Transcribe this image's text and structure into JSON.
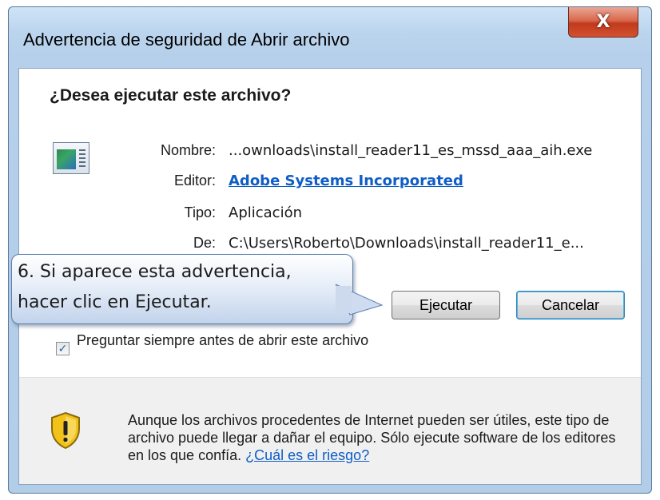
{
  "dialog": {
    "title": "Advertencia de seguridad de Abrir archivo",
    "close_label": "X",
    "question": "¿Desea ejecutar este archivo?",
    "fields": {
      "name_label": "Nombre:",
      "name_value": "...ownloads\\install_reader11_es_mssd_aaa_aih.exe",
      "publisher_label": "Editor:",
      "publisher_value": "Adobe Systems Incorporated",
      "type_label": "Tipo:",
      "type_value": "Aplicación",
      "from_label": "De:",
      "from_value": "C:\\Users\\Roberto\\Downloads\\install_reader11_e..."
    },
    "buttons": {
      "run": "Ejecutar",
      "cancel": "Cancelar"
    },
    "checkbox": {
      "label": "Preguntar siempre antes de abrir este archivo",
      "checked": true
    },
    "warning": {
      "text": "Aunque los archivos procedentes de Internet pueden ser útiles, este tipo de archivo puede llegar a dañar el equipo. Sólo ejecute software de los editores en los que confía.",
      "link": "¿Cuál es el riesgo?"
    },
    "icons": {
      "file": "application-file-icon",
      "shield": "warning-shield-icon",
      "close": "close-icon"
    }
  },
  "callout": {
    "line1": "6. Si aparece esta advertencia,",
    "line2": "hacer clic en Ejecutar."
  },
  "colors": {
    "link": "#0f5ec6",
    "close_button": "#c23a1e",
    "shield_yellow": "#f2c219"
  }
}
